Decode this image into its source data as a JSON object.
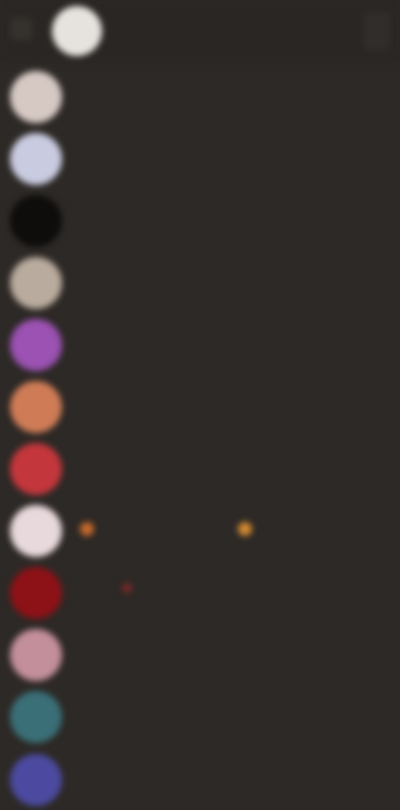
{
  "header": {
    "title": "",
    "avatar_color": "#e6e3df"
  },
  "icons": {
    "back": "back-icon",
    "menu": "more-options-icon"
  },
  "rows": [
    {
      "label": "",
      "avatar_color": "#d6c9c4"
    },
    {
      "label": "",
      "avatar_color": "#c9cbe0"
    },
    {
      "label": "",
      "avatar_color": "#0e0d0c"
    },
    {
      "label": "",
      "avatar_color": "#b9ab9d"
    },
    {
      "label": "",
      "avatar_color": "#9b52b2"
    },
    {
      "label": "",
      "avatar_color": "#cf7c56"
    },
    {
      "label": "",
      "avatar_color": "#c3373c"
    },
    {
      "label": "",
      "avatar_color": "#e8d9dc"
    },
    {
      "label": "",
      "avatar_color": "#8d1217"
    },
    {
      "label": "",
      "avatar_color": "#c38f9b"
    },
    {
      "label": "",
      "avatar_color": "#3a6f77"
    },
    {
      "label": "",
      "avatar_color": "#4c4aa0"
    }
  ],
  "emoji_dots": [
    {
      "color": "#c86a2b"
    },
    {
      "color": "#d48b32"
    },
    {
      "color": "#7a2a2a"
    }
  ]
}
